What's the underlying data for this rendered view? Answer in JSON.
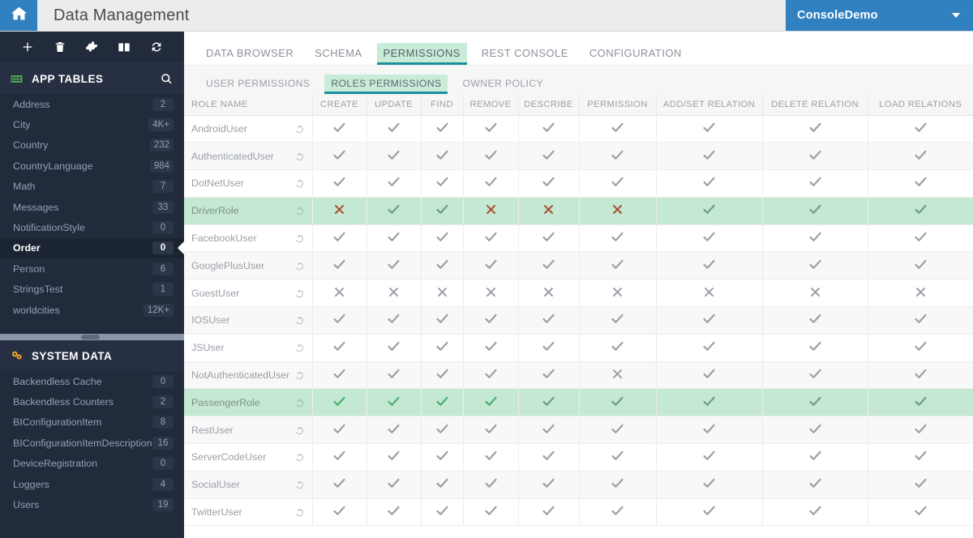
{
  "header": {
    "home_icon": "home-icon",
    "title": "Data Management",
    "console_name": "ConsoleDemo",
    "caret_icon": "chevron-down-icon",
    "accent_blue": "#3180c0"
  },
  "sidebar": {
    "toolbar": [
      {
        "icon": "plus-icon",
        "name": "add-table-button"
      },
      {
        "icon": "trash-icon",
        "name": "delete-table-button"
      },
      {
        "icon": "gear-icon",
        "name": "settings-button"
      },
      {
        "icon": "book-icon",
        "name": "docs-button"
      },
      {
        "icon": "refresh-icon",
        "name": "refresh-button"
      }
    ],
    "app_tables": {
      "title": "APP TABLES",
      "icon": "tables-icon",
      "search_icon": "search-icon",
      "items": [
        {
          "label": "Address",
          "count": "2",
          "selected": false
        },
        {
          "label": "City",
          "count": "4K+",
          "selected": false
        },
        {
          "label": "Country",
          "count": "232",
          "selected": false
        },
        {
          "label": "CountryLanguage",
          "count": "984",
          "selected": false
        },
        {
          "label": "Math",
          "count": "7",
          "selected": false
        },
        {
          "label": "Messages",
          "count": "33",
          "selected": false
        },
        {
          "label": "NotificationStyle",
          "count": "0",
          "selected": false
        },
        {
          "label": "Order",
          "count": "0",
          "selected": true
        },
        {
          "label": "Person",
          "count": "6",
          "selected": false
        },
        {
          "label": "StringsTest",
          "count": "1",
          "selected": false
        },
        {
          "label": "worldcities",
          "count": "12K+",
          "selected": false
        }
      ]
    },
    "system_data": {
      "title": "SYSTEM DATA",
      "icon": "cogs-icon",
      "items": [
        {
          "label": "Backendless Cache",
          "count": "0",
          "selected": false
        },
        {
          "label": "Backendless Counters",
          "count": "2",
          "selected": false
        },
        {
          "label": "BIConfigurationItem",
          "count": "8",
          "selected": false
        },
        {
          "label": "BIConfigurationItemDescription",
          "count": "16",
          "selected": false
        },
        {
          "label": "DeviceRegistration",
          "count": "0",
          "selected": false
        },
        {
          "label": "Loggers",
          "count": "4",
          "selected": false
        },
        {
          "label": "Users",
          "count": "19",
          "selected": false
        }
      ]
    }
  },
  "tabs_primary": [
    {
      "label": "DATA BROWSER",
      "active": false
    },
    {
      "label": "SCHEMA",
      "active": false
    },
    {
      "label": "PERMISSIONS",
      "active": true
    },
    {
      "label": "REST CONSOLE",
      "active": false
    },
    {
      "label": "CONFIGURATION",
      "active": false
    }
  ],
  "tabs_secondary": [
    {
      "label": "USER PERMISSIONS",
      "active": false
    },
    {
      "label": "ROLES PERMISSIONS",
      "active": true
    },
    {
      "label": "OWNER POLICY",
      "active": false
    }
  ],
  "permissions_grid": {
    "columns": [
      "ROLE NAME",
      "CREATE",
      "UPDATE",
      "FIND",
      "REMOVE",
      "DESCRIBE",
      "PERMISSION",
      "ADD/SET RELATION",
      "DELETE RELATION",
      "LOAD RELATIONS"
    ],
    "revert_icon": "revert-icon",
    "rows": [
      {
        "role": "AndroidUser",
        "highlight": false,
        "cells": [
          "check-gray",
          "check-gray",
          "check-gray",
          "check-gray",
          "check-gray",
          "check-gray",
          "check-gray",
          "check-gray",
          "check-gray"
        ]
      },
      {
        "role": "AuthenticatedUser",
        "highlight": false,
        "cells": [
          "check-gray",
          "check-gray",
          "check-gray",
          "check-gray",
          "check-gray",
          "check-gray",
          "check-gray",
          "check-gray",
          "check-gray"
        ]
      },
      {
        "role": "DotNetUser",
        "highlight": false,
        "cells": [
          "check-gray",
          "check-gray",
          "check-gray",
          "check-gray",
          "check-gray",
          "check-gray",
          "check-gray",
          "check-gray",
          "check-gray"
        ]
      },
      {
        "role": "DriverRole",
        "highlight": true,
        "cells": [
          "x-red",
          "check-dgreen",
          "check-dgreen",
          "x-red",
          "x-red",
          "x-red",
          "check-dgreen",
          "check-dgreen",
          "check-dgreen"
        ]
      },
      {
        "role": "FacebookUser",
        "highlight": false,
        "cells": [
          "check-gray",
          "check-gray",
          "check-gray",
          "check-gray",
          "check-gray",
          "check-gray",
          "check-gray",
          "check-gray",
          "check-gray"
        ]
      },
      {
        "role": "GooglePlusUser",
        "highlight": false,
        "cells": [
          "check-gray",
          "check-gray",
          "check-gray",
          "check-gray",
          "check-gray",
          "check-gray",
          "check-gray",
          "check-gray",
          "check-gray"
        ]
      },
      {
        "role": "GuestUser",
        "highlight": false,
        "cells": [
          "x-gray",
          "x-gray",
          "x-gray",
          "x-gray",
          "x-gray",
          "x-gray",
          "x-gray",
          "x-gray",
          "x-gray"
        ]
      },
      {
        "role": "IOSUser",
        "highlight": false,
        "cells": [
          "check-gray",
          "check-gray",
          "check-gray",
          "check-gray",
          "check-gray",
          "check-gray",
          "check-gray",
          "check-gray",
          "check-gray"
        ]
      },
      {
        "role": "JSUser",
        "highlight": false,
        "cells": [
          "check-gray",
          "check-gray",
          "check-gray",
          "check-gray",
          "check-gray",
          "check-gray",
          "check-gray",
          "check-gray",
          "check-gray"
        ]
      },
      {
        "role": "NotAuthenticatedUser",
        "highlight": false,
        "cells": [
          "check-gray",
          "check-gray",
          "check-gray",
          "check-gray",
          "check-gray",
          "x-gray",
          "check-gray",
          "check-gray",
          "check-gray"
        ]
      },
      {
        "role": "PassengerRole",
        "highlight": true,
        "cells": [
          "check-green",
          "check-green",
          "check-green",
          "check-green",
          "check-dgreen",
          "check-dgreen",
          "check-dgreen",
          "check-dgreen",
          "check-dgreen"
        ]
      },
      {
        "role": "RestUser",
        "highlight": false,
        "cells": [
          "check-gray",
          "check-gray",
          "check-gray",
          "check-gray",
          "check-gray",
          "check-gray",
          "check-gray",
          "check-gray",
          "check-gray"
        ]
      },
      {
        "role": "ServerCodeUser",
        "highlight": false,
        "cells": [
          "check-gray",
          "check-gray",
          "check-gray",
          "check-gray",
          "check-gray",
          "check-gray",
          "check-gray",
          "check-gray",
          "check-gray"
        ]
      },
      {
        "role": "SocialUser",
        "highlight": false,
        "cells": [
          "check-gray",
          "check-gray",
          "check-gray",
          "check-gray",
          "check-gray",
          "check-gray",
          "check-gray",
          "check-gray",
          "check-gray"
        ]
      },
      {
        "role": "TwitterUser",
        "highlight": false,
        "cells": [
          "check-gray",
          "check-gray",
          "check-gray",
          "check-gray",
          "check-gray",
          "check-gray",
          "check-gray",
          "check-gray",
          "check-gray"
        ]
      }
    ]
  },
  "colors": {
    "sidebar_bg": "#222b3c",
    "highlight_row": "#c4e8d1",
    "tab_active_bg": "#c9ecd9",
    "tab_underline": "#1b8f9e",
    "deny_red": "#a4522e",
    "allow_green": "#4caf72"
  }
}
